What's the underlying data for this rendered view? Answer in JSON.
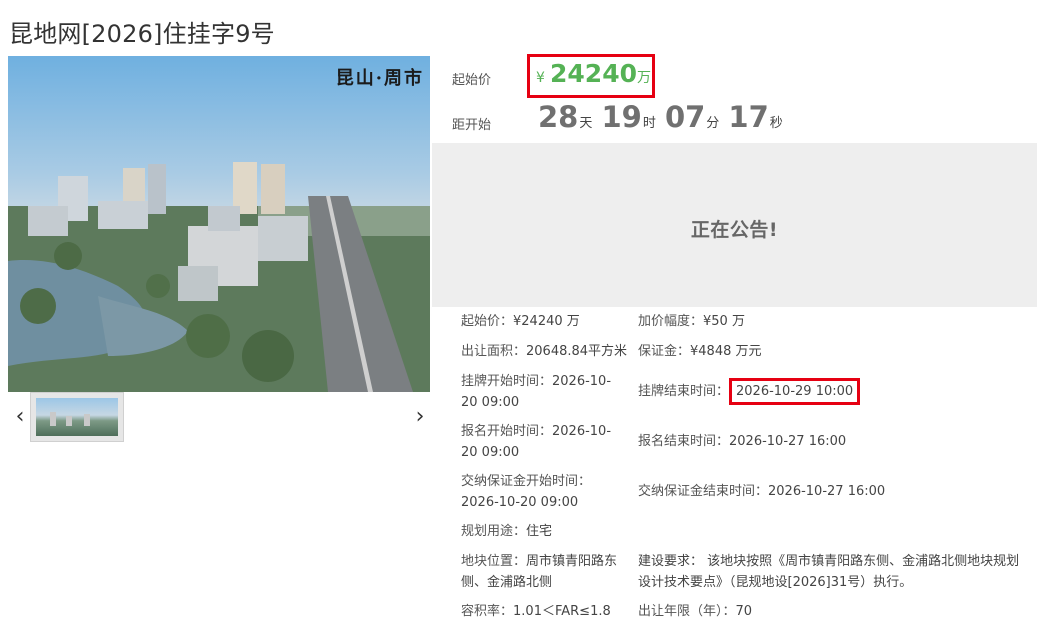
{
  "title": "昆地网[2026]住挂字9号",
  "photo": {
    "caption": "昆山·周市"
  },
  "gallery": {
    "prev_icon": "‹",
    "next_icon": "›"
  },
  "price": {
    "label": "起始价",
    "currency": "¥",
    "value": "24240",
    "unit": "万"
  },
  "countdown": {
    "label": "距开始",
    "days": "28",
    "days_unit": "天",
    "hours": "19",
    "hours_unit": "时",
    "minutes": "07",
    "minutes_unit": "分",
    "seconds": "17",
    "seconds_unit": "秒"
  },
  "notice": "正在公告!",
  "details": {
    "start_price": {
      "key": "起始价：",
      "value": "¥24240 万"
    },
    "increment": {
      "key": "加价幅度：",
      "value": "¥50 万"
    },
    "area": {
      "key": "出让面积：",
      "value": "20648.84平方米"
    },
    "deposit": {
      "key": "保证金：",
      "value": "¥4848 万元"
    },
    "listing_start": {
      "key": "挂牌开始时间：",
      "value1": "2026-10-",
      "value2": "20 09:00"
    },
    "listing_end": {
      "key": "挂牌结束时间：",
      "value": "2026-10-29 10:00"
    },
    "signup_start": {
      "key": "报名开始时间：",
      "value1": "2026-10-",
      "value2": "20 09:00"
    },
    "signup_end": {
      "key": "报名结束时间：",
      "value": "2026-10-27 16:00"
    },
    "deposit_start": {
      "key": "交纳保证金开始时间：",
      "value": "2026-10-20 09:00"
    },
    "deposit_end": {
      "key": "交纳保证金结束时间：",
      "value": "2026-10-27 16:00"
    },
    "usage": {
      "key": "规划用途：",
      "value": "住宅"
    },
    "location": {
      "key": "地块位置：",
      "value1": "周市镇青阳路东",
      "value2": "侧、金浦路北侧"
    },
    "requirement": {
      "line1": "建设要求： 该地块按照《周市镇青阳路东侧、金浦路北侧地块规划",
      "line2": "设计技术要点》（昆规地设[2026]31号）执行。"
    },
    "far": {
      "key": "容积率：",
      "value": "1.01＜FAR≤1.8"
    },
    "term": {
      "key": "出让年限（年）：",
      "value": "70"
    }
  },
  "colors": {
    "price_green": "#55b255",
    "highlight_red": "#e60012",
    "notice_bg": "#eeeeee"
  }
}
